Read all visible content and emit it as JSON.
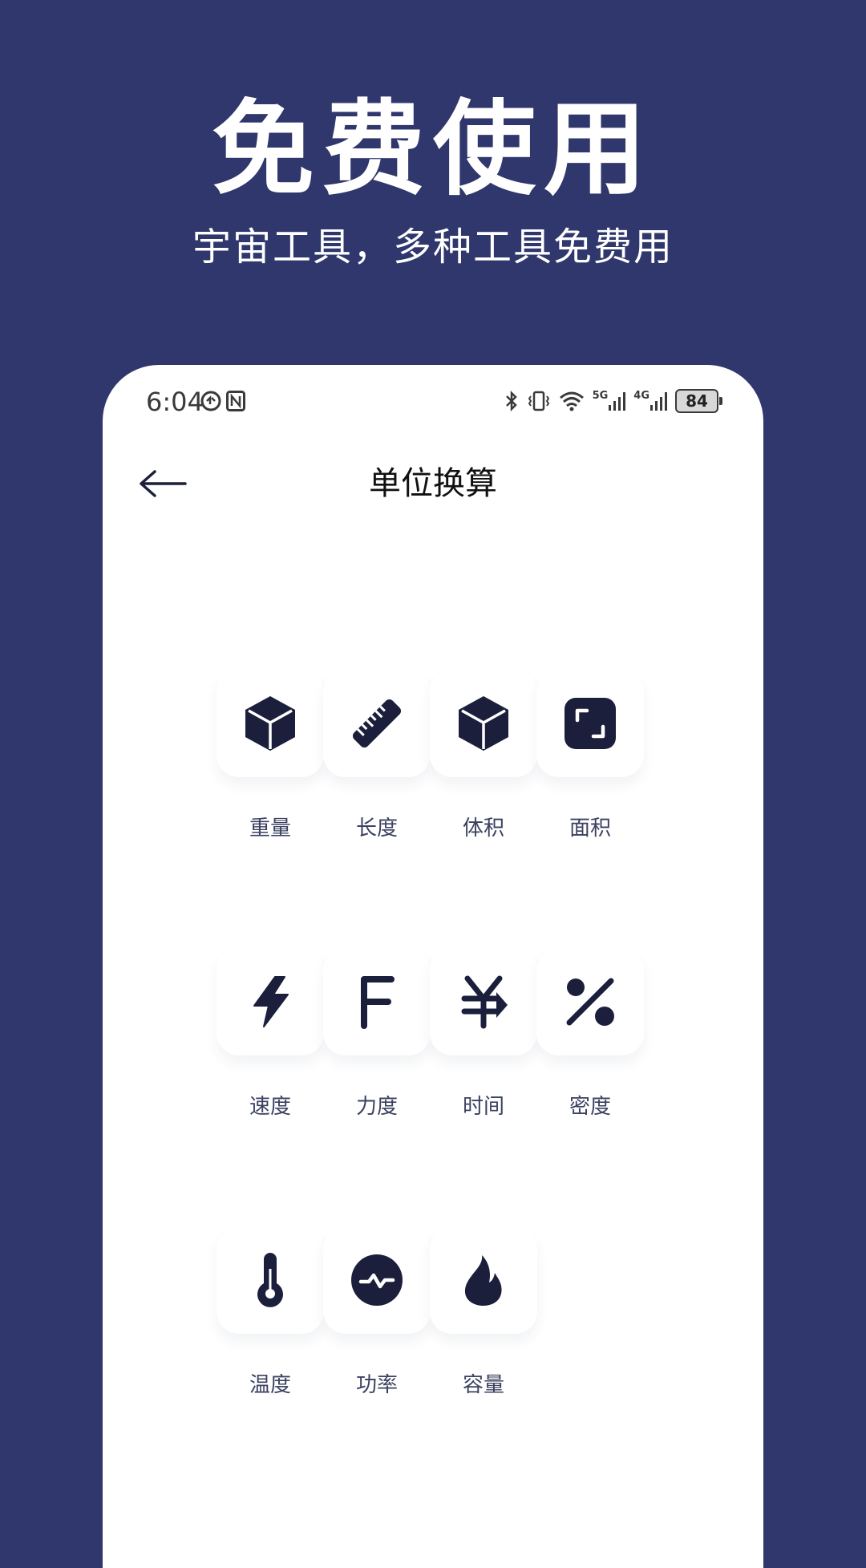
{
  "promo": {
    "title": "免费使用",
    "subtitle": "宇宙工具，多种工具免费用"
  },
  "status_bar": {
    "time": "6:04",
    "network_labels": [
      "5G",
      "4G"
    ],
    "battery": "84"
  },
  "app_bar": {
    "title": "单位换算",
    "back_icon": "arrow-left-icon"
  },
  "converters": [
    {
      "label": "重量",
      "icon": "cube-icon"
    },
    {
      "label": "长度",
      "icon": "ruler-icon"
    },
    {
      "label": "体积",
      "icon": "cube-icon"
    },
    {
      "label": "面积",
      "icon": "area-frame-icon"
    },
    {
      "label": "速度",
      "icon": "lightning-icon"
    },
    {
      "label": "力度",
      "icon": "letter-f-icon"
    },
    {
      "label": "时间",
      "icon": "yen-arrow-icon"
    },
    {
      "label": "密度",
      "icon": "percent-icon"
    },
    {
      "label": "温度",
      "icon": "thermometer-icon"
    },
    {
      "label": "功率",
      "icon": "pulse-icon"
    },
    {
      "label": "容量",
      "icon": "flame-icon"
    }
  ],
  "colors": {
    "background": "#2f376c",
    "icon": "#1b1f3b",
    "label": "#3b4160",
    "card": "#ffffff"
  }
}
